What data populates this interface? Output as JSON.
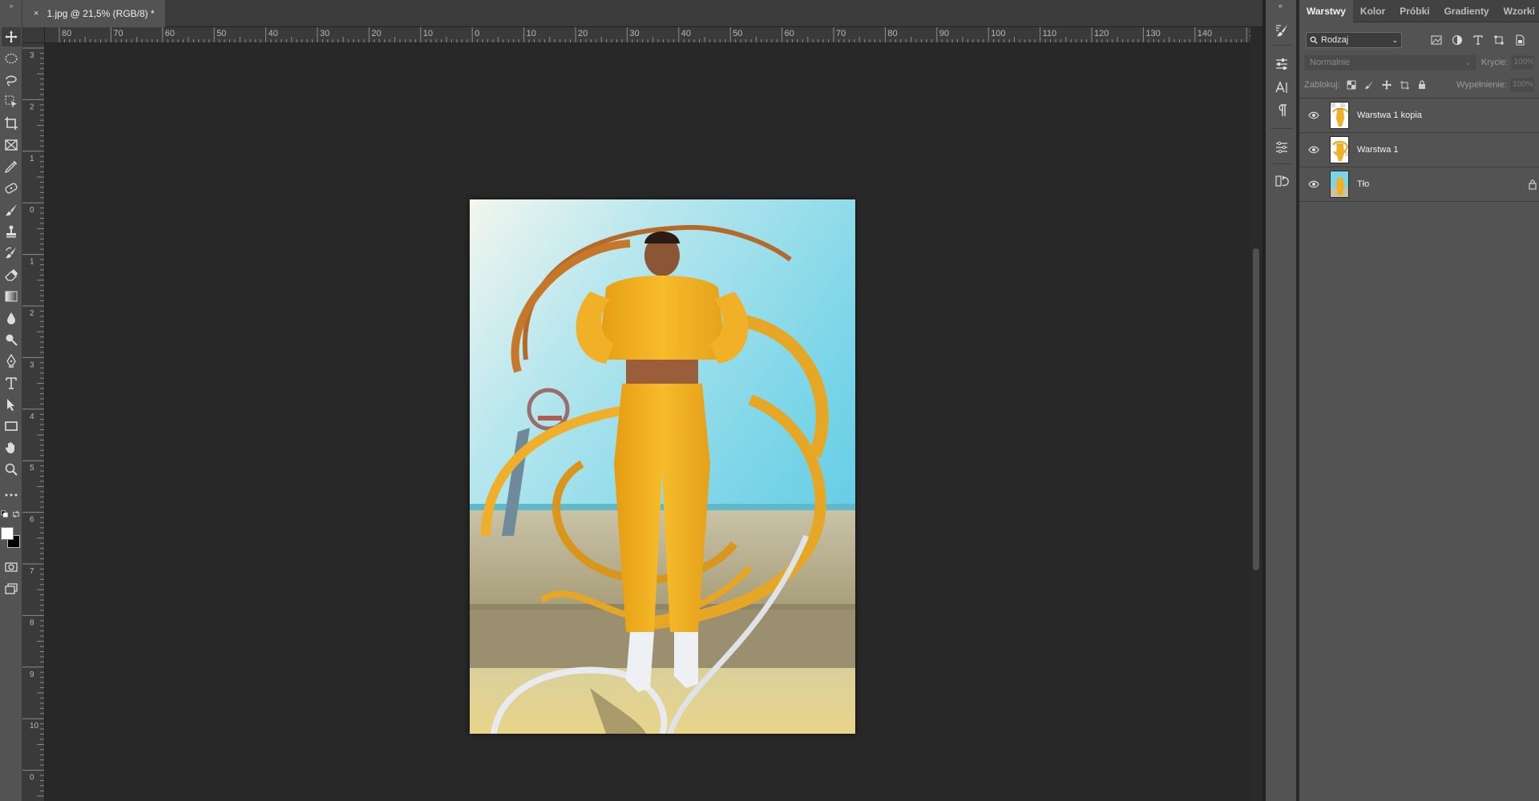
{
  "document": {
    "tab_title": "1.jpg @ 21,5% (RGB/8) *",
    "close_symbol": "×"
  },
  "ruler_top": [
    "80",
    "70",
    "60",
    "50",
    "40",
    "30",
    "20",
    "10",
    "0",
    "10",
    "20",
    "30",
    "40",
    "50",
    "60",
    "70",
    "80",
    "90",
    "100",
    "110",
    "120",
    "130",
    "140",
    "15"
  ],
  "ruler_left": [
    "3",
    "2",
    "1",
    "0",
    "1",
    "2",
    "3",
    "4",
    "5",
    "6",
    "7",
    "8",
    "9",
    "10",
    "0"
  ],
  "toolbar": {
    "tools": [
      "move-icon",
      "marquee-ellipse-icon",
      "lasso-icon",
      "object-select-icon",
      "crop-icon",
      "frame-icon",
      "eyedropper-icon",
      "healing-brush-icon",
      "brush-icon",
      "clone-stamp-icon",
      "history-brush-icon",
      "eraser-icon",
      "gradient-icon",
      "blur-icon",
      "dodge-icon",
      "pen-icon",
      "type-icon",
      "path-select-icon",
      "rectangle-icon",
      "hand-rotate-icon",
      "zoom-icon",
      "more-tools-icon",
      "default-colors-icon",
      "swap-colors-icon",
      "color-swatches-icon",
      "quick-mask-icon",
      "screen-mode-icon"
    ]
  },
  "dock": {
    "icons": [
      "brush-settings-icon",
      "properties-icon",
      "character-icon",
      "paragraph-icon",
      "adjustments-icon",
      "history-icon"
    ]
  },
  "panel": {
    "tabs": [
      "Warstwy",
      "Kolor",
      "Próbki",
      "Gradienty",
      "Wzorki"
    ],
    "active_tab": "Warstwy",
    "filter_label": "Rodzaj",
    "blend_mode": "Normalnie",
    "opacity_label": "Krycie:",
    "opacity_value": "100%",
    "lock_label": "Zablokuj:",
    "fill_label": "Wypełnienie:",
    "fill_value": "100%",
    "layers": [
      {
        "name": "Warstwa 1 kopia",
        "visible": true,
        "locked": false
      },
      {
        "name": "Warstwa 1",
        "visible": true,
        "locked": false
      },
      {
        "name": "Tło",
        "visible": true,
        "locked": true
      }
    ]
  },
  "colors": {
    "ui_dark": "#535353",
    "canvas_bg": "#282828",
    "accent_yellow": "#f2b01e",
    "sky": "#7fd3e6"
  }
}
